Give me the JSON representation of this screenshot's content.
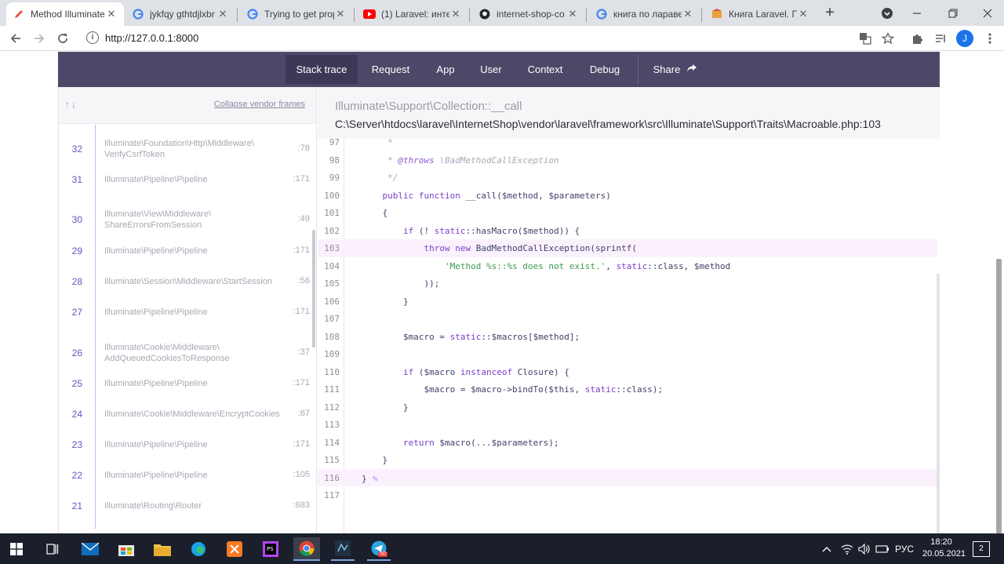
{
  "browser": {
    "tabs": [
      {
        "title": "Method Illuminate",
        "icon": "ignition-pencil-icon",
        "active": true
      },
      {
        "title": "jykfqy gthtdjlxbr",
        "icon": "google-icon",
        "active": false
      },
      {
        "title": "Trying to get prop",
        "icon": "google-icon",
        "active": false
      },
      {
        "title": "(1) Laravel: интер",
        "icon": "youtube-icon",
        "active": false
      },
      {
        "title": "internet-shop-co",
        "icon": "github-icon",
        "active": false
      },
      {
        "title": "книга по ларавел",
        "icon": "google-icon",
        "active": false
      },
      {
        "title": "Книга Laravel. По",
        "icon": "book-icon",
        "active": false
      }
    ],
    "new_tab": "+",
    "url": "http://127.0.0.1:8000",
    "avatar_letter": "J"
  },
  "ignition": {
    "nav": [
      "Stack trace",
      "Request",
      "App",
      "User",
      "Context",
      "Debug"
    ],
    "share": "Share",
    "collapse_label": "Collapse vendor frames",
    "frames": [
      {
        "num": "32",
        "cls": "Illuminate\\Foundation\\Http\\Middleware\\ VerifyCsrfToken",
        "line": ":78"
      },
      {
        "num": "31",
        "cls": "Illuminate\\Pipeline\\Pipeline",
        "line": ":171"
      },
      {
        "num": "30",
        "cls": "Illuminate\\View\\Middleware\\ ShareErrorsFromSession",
        "line": ":49"
      },
      {
        "num": "29",
        "cls": "Illuminate\\Pipeline\\Pipeline",
        "line": ":171"
      },
      {
        "num": "28",
        "cls": "Illuminate\\Session\\Middleware\\StartSession",
        "line": ":56"
      },
      {
        "num": "27",
        "cls": "Illuminate\\Pipeline\\Pipeline",
        "line": ":171"
      },
      {
        "num": "26",
        "cls": "Illuminate\\Cookie\\Middleware\\ AddQueuedCookiesToResponse",
        "line": ":37"
      },
      {
        "num": "25",
        "cls": "Illuminate\\Pipeline\\Pipeline",
        "line": ":171"
      },
      {
        "num": "24",
        "cls": "Illuminate\\Cookie\\Middleware\\EncryptCookies",
        "line": ":67"
      },
      {
        "num": "23",
        "cls": "Illuminate\\Pipeline\\Pipeline",
        "line": ":171"
      },
      {
        "num": "22",
        "cls": "Illuminate\\Pipeline\\Pipeline",
        "line": ":105"
      },
      {
        "num": "21",
        "cls": "Illuminate\\Routing\\Router",
        "line": ":683"
      }
    ],
    "frame_class": "Illuminate\\Support\\Collection::__call",
    "frame_path": "C:\\Server\\htdocs\\laravel\\InternetShop\\vendor\\laravel\\framework\\src\\Illuminate\\Support\\Traits\\Macroable.php:103",
    "highlighted_lines": [
      "103",
      "116"
    ],
    "code": [
      {
        "no": "97",
        "text": "     *"
      },
      {
        "no": "98",
        "text": "     * @throws \\BadMethodCallException"
      },
      {
        "no": "99",
        "text": "     */"
      },
      {
        "no": "100",
        "text": "    public function __call($method, $parameters)"
      },
      {
        "no": "101",
        "text": "    {"
      },
      {
        "no": "102",
        "text": "        if (! static::hasMacro($method)) {"
      },
      {
        "no": "103",
        "text": "            throw new BadMethodCallException(sprintf("
      },
      {
        "no": "104",
        "text": "                'Method %s::%s does not exist.', static::class, $method"
      },
      {
        "no": "105",
        "text": "            ));"
      },
      {
        "no": "106",
        "text": "        }"
      },
      {
        "no": "107",
        "text": ""
      },
      {
        "no": "108",
        "text": "        $macro = static::$macros[$method];"
      },
      {
        "no": "109",
        "text": ""
      },
      {
        "no": "110",
        "text": "        if ($macro instanceof Closure) {"
      },
      {
        "no": "111",
        "text": "            $macro = $macro->bindTo($this, static::class);"
      },
      {
        "no": "112",
        "text": "        }"
      },
      {
        "no": "113",
        "text": ""
      },
      {
        "no": "114",
        "text": "        return $macro(...$parameters);"
      },
      {
        "no": "115",
        "text": "    }"
      },
      {
        "no": "116",
        "text": "}"
      },
      {
        "no": "117",
        "text": ""
      }
    ]
  },
  "taskbar": {
    "lang": "РУС",
    "time": "18:20",
    "date": "20.05.2021",
    "notifications": "2",
    "telegram_badge": "50"
  },
  "colors": {
    "nav_bg": "#4d4868",
    "accent": "#6a4fc2",
    "highlight_line": "#fbf1fd"
  }
}
